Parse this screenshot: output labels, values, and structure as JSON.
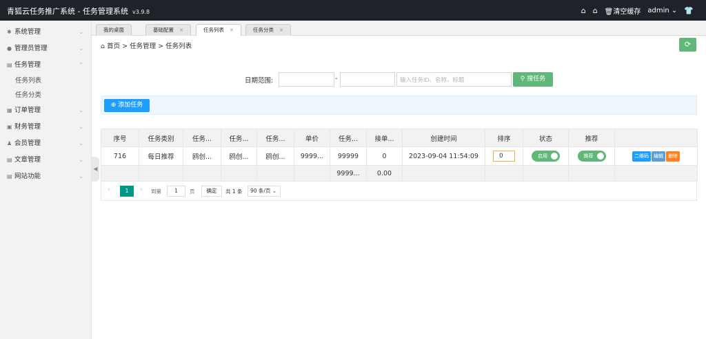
{
  "header": {
    "title": "青狐云任务推广系统 - 任务管理系统",
    "version": "v3.9.8",
    "clear_cache": "清空缓存",
    "user": "admin"
  },
  "sidebar": {
    "items": [
      {
        "label": "系统管理",
        "icon": "gear-icon"
      },
      {
        "label": "管理员管理",
        "icon": "user-icon"
      },
      {
        "label": "任务管理",
        "icon": "database-icon",
        "expanded": true,
        "children": [
          "任务列表",
          "任务分类"
        ]
      },
      {
        "label": "订单管理",
        "icon": "calendar-icon"
      },
      {
        "label": "财务管理",
        "icon": "money-icon"
      },
      {
        "label": "会员管理",
        "icon": "group-icon"
      },
      {
        "label": "文章管理",
        "icon": "article-icon"
      },
      {
        "label": "网站功能",
        "icon": "list-icon"
      }
    ]
  },
  "tabs": [
    {
      "label": "我的桌面",
      "closable": false
    },
    {
      "label": "基础配置",
      "closable": true
    },
    {
      "label": "任务列表",
      "closable": true,
      "active": true
    },
    {
      "label": "任务分类",
      "closable": true
    }
  ],
  "breadcrumb": {
    "home": "首页",
    "sep": ">",
    "level1": "任务管理",
    "level2": "任务列表"
  },
  "search": {
    "date_label": "日期范围:",
    "date_start": "",
    "date_end": "",
    "separator": "-",
    "keyword_placeholder": "输入任务ID、名称、标题",
    "button": "搜任务"
  },
  "toolbar": {
    "add_button": "添加任务"
  },
  "table": {
    "headers": [
      "序号",
      "任务类别",
      "任务...",
      "任务...",
      "任务...",
      "单价",
      "任务...",
      "接单...",
      "创建时间",
      "排序",
      "状态",
      "推荐",
      ""
    ],
    "rows": [
      {
        "id": "716",
        "category": "每日推荐",
        "c3": "鸥创...",
        "c4": "鸥创...",
        "c5": "鸥创...",
        "price": "9999...",
        "task_num": "99999",
        "accepted": "0",
        "created": "2023-09-04 11:54:09",
        "sort": "0",
        "status": "启用",
        "recommend": "推荐",
        "ops": [
          "二维码",
          "编辑",
          "删除"
        ]
      }
    ],
    "totals": {
      "task_num": "9999...",
      "accepted": "0.00"
    }
  },
  "pager": {
    "current": "1",
    "goto_label": "到第",
    "goto_value": "1",
    "page_label": "页",
    "confirm": "确定",
    "total": "共 1 条",
    "page_size": "90 条/页"
  },
  "colors": {
    "header_bg": "#20222a",
    "green": "#5fb878",
    "blue": "#1e9fff",
    "orange": "#ff7f1e",
    "teal": "#009688"
  }
}
